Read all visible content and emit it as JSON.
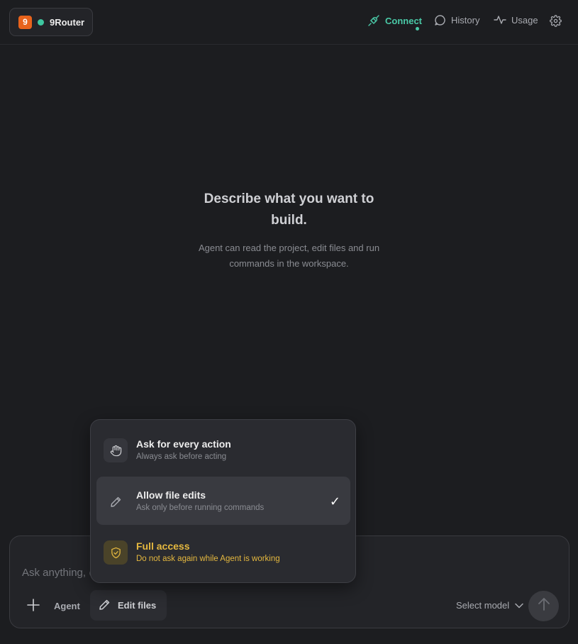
{
  "brand": {
    "logo_text": "9",
    "name": "9Router"
  },
  "nav": {
    "connect_label": "Connect",
    "history_label": "History",
    "usage_label": "Usage"
  },
  "empty_state": {
    "title": "Describe what you want to build.",
    "subtitle": "Agent can read the project, edit files and run commands in the workspace."
  },
  "composer": {
    "placeholder": "Ask anything, @ to mention files",
    "mode_label": "Agent",
    "permission_label": "Edit files",
    "model_label": "Select model"
  },
  "permission_menu": {
    "items": [
      {
        "title": "Ask for every action",
        "subtitle": "Always ask before acting",
        "icon": "hand-icon",
        "selected": false
      },
      {
        "title": "Allow file edits",
        "subtitle": "Ask only before running commands",
        "icon": "pencil-icon",
        "selected": true
      },
      {
        "title": "Full access",
        "subtitle": "Do not ask again while Agent is working",
        "icon": "shield-check-icon",
        "selected": false
      }
    ],
    "check_glyph": "✓"
  },
  "colors": {
    "background": "#1c1d20",
    "accent": "#4ac9a7",
    "brand_logo": "#e8631c",
    "warning": "#e5b83f"
  }
}
